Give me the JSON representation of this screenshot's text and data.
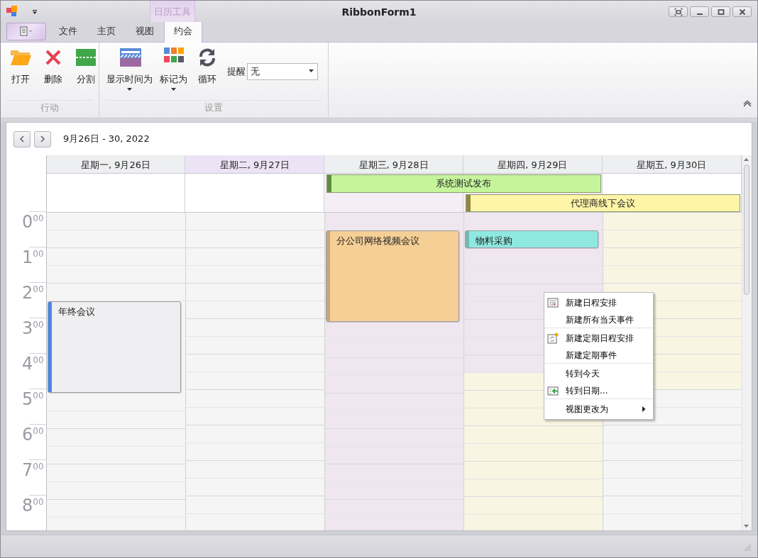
{
  "window": {
    "title": "RibbonForm1"
  },
  "ribbon": {
    "context_group": "日历工具",
    "tabs": [
      {
        "label": "文件",
        "selected": false
      },
      {
        "label": "主页",
        "selected": false
      },
      {
        "label": "视图",
        "selected": false
      },
      {
        "label": "约会",
        "selected": true
      }
    ],
    "groups": [
      {
        "label": "行动",
        "items": [
          {
            "kind": "open",
            "label": "打开",
            "dropdown": false
          },
          {
            "kind": "delete",
            "label": "删除",
            "dropdown": false
          },
          {
            "kind": "split",
            "label": "分割",
            "dropdown": false
          }
        ]
      },
      {
        "label": "设置",
        "items": [
          {
            "kind": "showtime",
            "label": "显示时间为",
            "dropdown": true
          },
          {
            "kind": "mark",
            "label": "标记为",
            "dropdown": true
          },
          {
            "kind": "recur",
            "label": "循环",
            "dropdown": false
          },
          {
            "kind": "combo",
            "label": "提醒",
            "value": "无"
          }
        ]
      }
    ]
  },
  "calendar": {
    "range": "9月26日 - 30, 2022",
    "days": [
      {
        "header": "星期一, 9月26日",
        "today": false,
        "allday_selected": false,
        "slots": [
          {
            "kind": "plain",
            "in_event": false
          },
          {
            "kind": "plain",
            "in_event": false
          },
          {
            "kind": "plain",
            "in_event": false
          },
          {
            "kind": "plain",
            "in_event": false
          },
          {
            "kind": "plain",
            "in_event": false
          },
          {
            "kind": "plain",
            "in_event": true,
            "event": {
              "title": "年终会议",
              "color": "#4a86e8"
            }
          },
          {
            "kind": "plain",
            "in_event": true
          },
          {
            "kind": "plain",
            "in_event": true
          },
          {
            "kind": "plain",
            "in_event": true
          },
          {
            "kind": "plain",
            "in_event": true
          },
          {
            "kind": "plain",
            "in_event": false
          },
          {
            "kind": "plain",
            "in_event": false
          },
          {
            "kind": "plain",
            "in_event": false
          },
          {
            "kind": "plain",
            "in_event": false
          },
          {
            "kind": "plain",
            "in_event": false
          },
          {
            "kind": "plain",
            "in_event": false
          },
          {
            "kind": "plain",
            "in_event": false
          },
          {
            "kind": "plain",
            "in_event": false
          }
        ]
      },
      {
        "header": "星期二, 9月27日",
        "today": true,
        "allday_selected": false,
        "slots": [
          {
            "kind": "plain",
            "in_event": false
          },
          {
            "kind": "plain",
            "in_event": false
          },
          {
            "kind": "plain",
            "in_event": false
          },
          {
            "kind": "plain",
            "in_event": false
          },
          {
            "kind": "plain",
            "in_event": false
          },
          {
            "kind": "plain",
            "in_event": false
          },
          {
            "kind": "plain",
            "in_event": false
          },
          {
            "kind": "plain",
            "in_event": false
          },
          {
            "kind": "plain",
            "in_event": false
          },
          {
            "kind": "plain",
            "in_event": false
          },
          {
            "kind": "plain",
            "in_event": false
          },
          {
            "kind": "plain",
            "in_event": false
          },
          {
            "kind": "plain",
            "in_event": false
          },
          {
            "kind": "plain",
            "in_event": false
          },
          {
            "kind": "plain",
            "in_event": false
          },
          {
            "kind": "plain",
            "in_event": false
          },
          {
            "kind": "plain",
            "in_event": false
          },
          {
            "kind": "plain",
            "in_event": false
          }
        ]
      },
      {
        "header": "星期三, 9月28日",
        "today": false,
        "allday_selected": true,
        "slots": [
          {
            "kind": "selected",
            "in_event": false
          },
          {
            "kind": "selected",
            "in_event": true,
            "event": {
              "title": "分公司网络视频会议",
              "color": "#f5cf95"
            }
          },
          {
            "kind": "selected",
            "in_event": true
          },
          {
            "kind": "selected",
            "in_event": true
          },
          {
            "kind": "selected",
            "in_event": true
          },
          {
            "kind": "selected",
            "in_event": true
          },
          {
            "kind": "selected",
            "in_event": false
          },
          {
            "kind": "selected",
            "in_event": false
          },
          {
            "kind": "selected",
            "in_event": false
          },
          {
            "kind": "selected",
            "in_event": false
          },
          {
            "kind": "selected",
            "in_event": false
          },
          {
            "kind": "selected",
            "in_event": false
          },
          {
            "kind": "selected",
            "in_event": false
          },
          {
            "kind": "selected",
            "in_event": false
          },
          {
            "kind": "selected",
            "in_event": false
          },
          {
            "kind": "selected",
            "in_event": false
          },
          {
            "kind": "selected",
            "in_event": false
          },
          {
            "kind": "selected",
            "in_event": false
          }
        ]
      },
      {
        "header": "星期四, 9月29日",
        "today": false,
        "allday_selected": true,
        "slots": [
          {
            "kind": "selected",
            "in_event": false
          },
          {
            "kind": "selected",
            "in_event": true,
            "event": {
              "title": "物料采购",
              "color": "#8ee8e0"
            }
          },
          {
            "kind": "selected",
            "in_event": false
          },
          {
            "kind": "selected",
            "in_event": false
          },
          {
            "kind": "selected",
            "in_event": false
          },
          {
            "kind": "selected",
            "in_event": false
          },
          {
            "kind": "selected",
            "in_event": false
          },
          {
            "kind": "selected",
            "in_event": false
          },
          {
            "kind": "selected",
            "in_event": false
          },
          {
            "kind": "work",
            "in_event": false
          },
          {
            "kind": "work",
            "in_event": false
          },
          {
            "kind": "work",
            "in_event": false
          },
          {
            "kind": "work",
            "in_event": false
          },
          {
            "kind": "work",
            "in_event": false
          },
          {
            "kind": "work",
            "in_event": false
          },
          {
            "kind": "work",
            "in_event": false
          },
          {
            "kind": "work",
            "in_event": false
          },
          {
            "kind": "work",
            "in_event": false
          }
        ]
      },
      {
        "header": "星期五, 9月30日",
        "today": false,
        "allday_selected": false,
        "slots": [
          {
            "kind": "work",
            "in_event": false
          },
          {
            "kind": "work",
            "in_event": false
          },
          {
            "kind": "work",
            "in_event": false
          },
          {
            "kind": "work",
            "in_event": false
          },
          {
            "kind": "work",
            "in_event": false
          },
          {
            "kind": "work",
            "in_event": false
          },
          {
            "kind": "work",
            "in_event": false
          },
          {
            "kind": "work",
            "in_event": false
          },
          {
            "kind": "work",
            "in_event": false
          },
          {
            "kind": "work",
            "in_event": false
          },
          {
            "kind": "plain",
            "in_event": false
          },
          {
            "kind": "plain",
            "in_event": false
          },
          {
            "kind": "plain",
            "in_event": false
          },
          {
            "kind": "plain",
            "in_event": false
          },
          {
            "kind": "plain",
            "in_event": false
          },
          {
            "kind": "plain",
            "in_event": false
          },
          {
            "kind": "plain",
            "in_event": false
          },
          {
            "kind": "plain",
            "in_event": false
          }
        ]
      }
    ],
    "allday_rows": [
      [
        {
          "kind": "empty"
        },
        {
          "kind": "empty"
        },
        {
          "kind": "event",
          "title": "系统测试发布",
          "color": "#c5f59b"
        },
        {
          "kind": "cont"
        },
        {
          "kind": "empty"
        }
      ],
      [
        {
          "kind": "empty"
        },
        {
          "kind": "empty"
        },
        {
          "kind": "empty"
        },
        {
          "kind": "event",
          "title": "代理商线下会议",
          "color": "#fff5a8"
        },
        {
          "kind": "cont"
        }
      ]
    ],
    "hours": [
      {
        "hour": "0",
        "minutes": "00"
      },
      {
        "hour": "1",
        "minutes": "00"
      },
      {
        "hour": "2",
        "minutes": "00"
      },
      {
        "hour": "3",
        "minutes": "00"
      },
      {
        "hour": "4",
        "minutes": "00"
      },
      {
        "hour": "5",
        "minutes": "00"
      },
      {
        "hour": "6",
        "minutes": "00"
      },
      {
        "hour": "7",
        "minutes": "00"
      },
      {
        "hour": "8",
        "minutes": "00"
      }
    ],
    "context_menu": {
      "items": [
        {
          "kind": "calendar",
          "label": "新建日程安排",
          "separator_after": false
        },
        {
          "kind": "plain",
          "label": "新建所有当天事件",
          "separator_after": true
        },
        {
          "kind": "recurring",
          "label": "新建定期日程安排",
          "separator_after": false
        },
        {
          "kind": "plain",
          "label": "新建定期事件",
          "separator_after": true
        },
        {
          "kind": "plain",
          "label": "转到今天",
          "separator_after": false
        },
        {
          "kind": "goto",
          "label": "转到日期...",
          "separator_after": true
        },
        {
          "kind": "submenu",
          "label": "视图更改为",
          "separator_after": false
        }
      ]
    }
  }
}
